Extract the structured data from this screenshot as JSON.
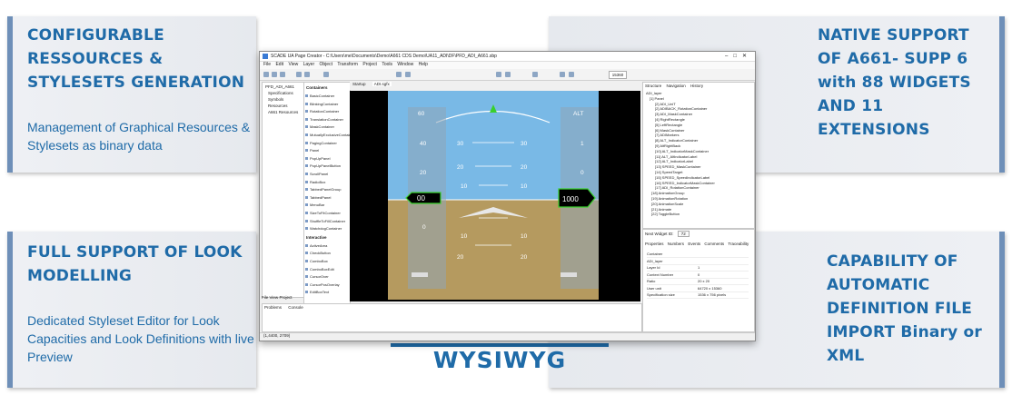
{
  "cards": {
    "top_left": {
      "title": "CONFIGURABLE RESSOURCES & STYLESETS GENERATION",
      "body": "Management of Graphical Resources & Stylesets as binary data"
    },
    "bottom_left": {
      "title": "FULL SUPPORT OF LOOK MODELLING",
      "body": "Dedicated Styleset Editor for Look Capacities and Look Definitions with live Preview"
    },
    "top_right": {
      "title": "NATIVE SUPPORT OF A661- SUPP 6 with 88 WIDGETS AND 11 EXTENSIONS"
    },
    "bottom_right": {
      "title": "CAPABILITY OF AUTOMATIC DEFINITION FILE IMPORT Binary or XML"
    }
  },
  "caption": "WYSIWYG",
  "colors": {
    "accent": "#1f6ba8",
    "card_border": "#6e8fb8",
    "sky": "#79b9e6",
    "ground": "#b59a5f"
  },
  "app": {
    "title": "SCADE UA Page Creator - C:\\Users\\me\\Documents\\Demo\\A661 CDS Demo\\UA11_ADI\\DF\\PFD_ADI_A661.sbp",
    "menu": [
      "File",
      "Edit",
      "View",
      "Layer",
      "Object",
      "Transform",
      "Project",
      "Tools",
      "Window",
      "Help"
    ],
    "zoom": "15360",
    "left_tree": [
      "PFD_ADI_A661",
      "Specifications",
      "Symbols",
      "Resources",
      "A661 Resources"
    ],
    "left_tabs": [
      "File View",
      "Project"
    ],
    "canvas_tabs": [
      "Startup",
      "ADI.sgfx"
    ],
    "palette": {
      "containers_header": "Containers",
      "containers": [
        "BasicContainer",
        "BlinkingContainer",
        "RotationContainer",
        "TranslationContainer",
        "MaskContainer",
        "MutuallyExclusiveContainer",
        "PagingContainer",
        "Panel",
        "PopUpPanel",
        "PopUpPanelButton",
        "ScrollPanel",
        "RadioBox",
        "TabbedPanelGroup",
        "TabbedPanel",
        "MenuBar",
        "SizeToFitContainer",
        "ShuffleToFillContainer",
        "WatchdogContainer"
      ],
      "interactive_header": "Interactive",
      "interactive": [
        "ActiveArea",
        "CheckButton",
        "ComboBox",
        "ComboBoxEdit",
        "CursorOver",
        "CursorPosOverlay",
        "EditBoxText"
      ]
    },
    "bottom_tabs": [
      "Problems",
      "Console"
    ],
    "status": "(1,4400, 2709)",
    "right_tabs": [
      "Structure",
      "Navigation",
      "History"
    ],
    "structure": [
      "ADI_layer",
      "[1] Panel",
      "[2] ADI_UniT",
      "[2] ADIBACK_RotationContainer",
      "[3] ADI_MaskContainer",
      "[4] RightRectangle",
      "[5] LeftRectangle",
      "[6] MaskContainer",
      "[7] ADIMarkers",
      "[8] ALT_IndicatorContainer",
      "[9] AltRightBack",
      "[10] ALT_IndicatorMaskContainer",
      "[11] ALT_AltIndicatorLabel",
      "[12] ALT_IndicatorLabel",
      "[13] SPEED_MaskContainer",
      "[14] SpeedTarget",
      "[15] SPEED_SpeedIndicatorLabel",
      "[16] SPEED_IndicatorMaskContainer",
      "[17] ADI_RotationContainer",
      "[18] AnimationGroup",
      "[19] AnimationRotation",
      "[20] AnimationScale",
      "[21] Animate",
      "[22] ToggleButton"
    ],
    "next_widget_id_label": "Next Widget ID:",
    "next_widget_id": "72",
    "prop_tabs": [
      "Properties",
      "Numbers",
      "Events",
      "Comments",
      "Traceability"
    ],
    "props": [
      {
        "k": "Container",
        "v": ""
      },
      {
        "k": "ADI_layer",
        "v": ""
      },
      {
        "k": "Layer Id",
        "v": "1"
      },
      {
        "k": "Context Number",
        "v": "0"
      },
      {
        "k": "Ratio",
        "v": "20 x 20"
      },
      {
        "k": "User unit",
        "v": "64720 x 15360"
      },
      {
        "k": "Specification size",
        "v": "1536 x 756 pixels"
      }
    ],
    "adi": {
      "speed_box": "00",
      "alt_box": "1000",
      "tape_top_left": "60",
      "tape_top_right": "ALT",
      "speed_ticks": [
        "40",
        "20",
        "0"
      ],
      "alt_ticks": [
        "1",
        "0"
      ],
      "pitch_up": [
        "30",
        "20",
        "10"
      ],
      "pitch_down": [
        "10",
        "20"
      ]
    }
  }
}
